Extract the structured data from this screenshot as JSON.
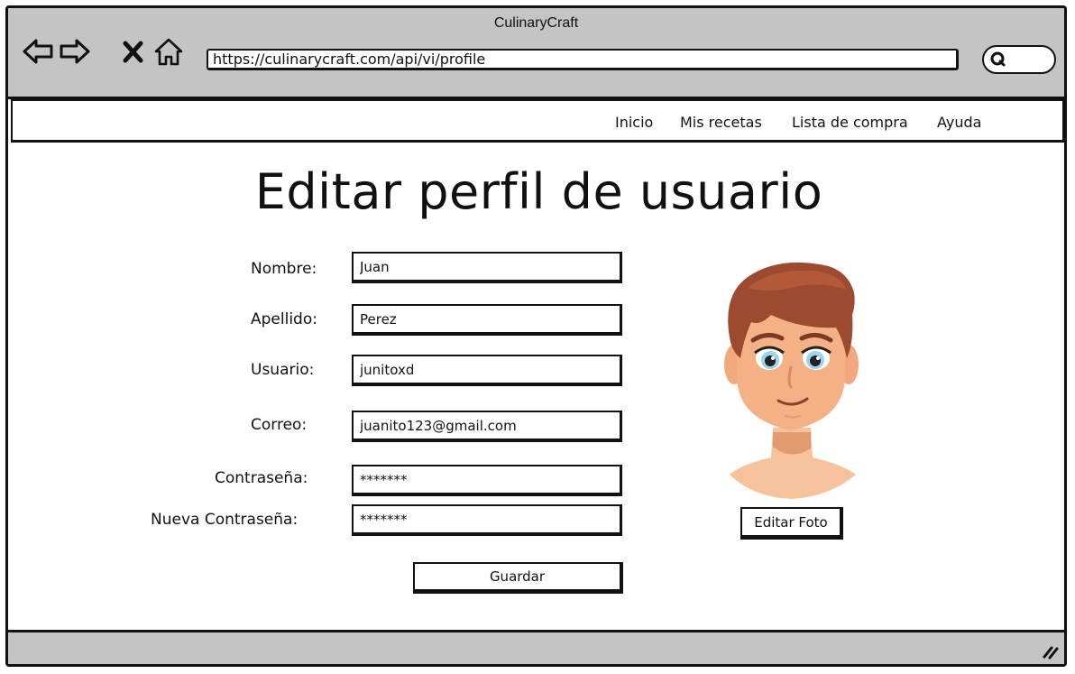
{
  "window": {
    "title": "CulinaryCraft"
  },
  "browser": {
    "url": "https://culinarycraft.com/api/vi/profile",
    "nav_icons": [
      "back-arrow-icon",
      "forward-arrow-icon",
      "close-x-icon",
      "home-icon"
    ],
    "search_icon": "search-icon"
  },
  "navbar": {
    "items": [
      {
        "label": "Inicio"
      },
      {
        "label": "Mis recetas"
      },
      {
        "label": "Lista de compra"
      },
      {
        "label": "Ayuda"
      }
    ]
  },
  "page": {
    "title": "Editar perfil de usuario"
  },
  "form": {
    "fields": [
      {
        "label": "Nombre:",
        "value": "Juan"
      },
      {
        "label": "Apellido:",
        "value": "Perez"
      },
      {
        "label": "Usuario:",
        "value": "junitoxd"
      },
      {
        "label": "Correo:",
        "value": "juanito123@gmail.com"
      },
      {
        "label": "Contraseña:",
        "value": "*******"
      },
      {
        "label": "Nueva Contraseña:",
        "value": "*******"
      }
    ],
    "save_label": "Guardar"
  },
  "profile": {
    "avatar_icon": "user-avatar-illustration",
    "edit_photo_label": "Editar Foto"
  },
  "colors": {
    "chrome": "#c4c4c4",
    "hair": "#9c4a30",
    "skin": "#f4b185",
    "eyes": "#9dd3ec"
  }
}
